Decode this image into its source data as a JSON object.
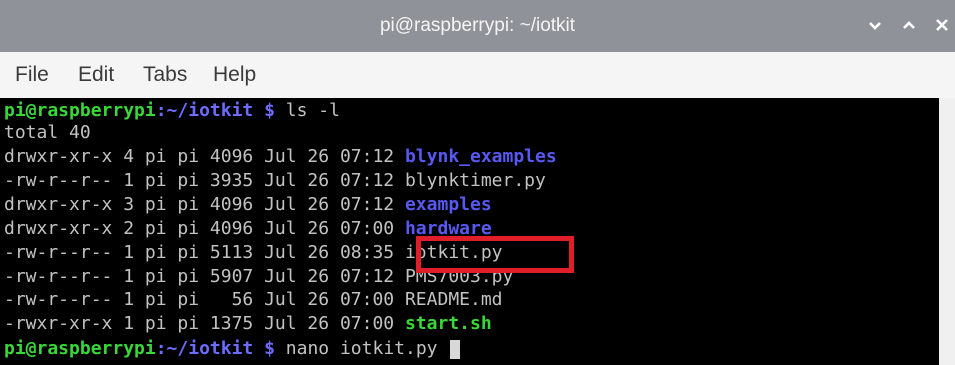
{
  "window": {
    "title": "pi@raspberrypi: ~/iotkit",
    "buttons": [
      "chevron-down-icon",
      "chevron-up-icon",
      "close-icon"
    ]
  },
  "menu": {
    "items": [
      "File",
      "Edit",
      "Tabs",
      "Help"
    ]
  },
  "terminal": {
    "prompt_user": "pi@raspberrypi",
    "prompt_path": ":~/iotkit",
    "prompt_symbol": " $",
    "command1": " ls -l",
    "total": "total 40",
    "entries": [
      {
        "meta": "drwxr-xr-x 4 pi pi 4096 Jul 26 07:12 ",
        "name": "blynk_examples",
        "kind": "dir"
      },
      {
        "meta": "-rw-r--r-- 1 pi pi 3935 Jul 26 07:12 ",
        "name": "blynktimer.py",
        "kind": "file"
      },
      {
        "meta": "drwxr-xr-x 3 pi pi 4096 Jul 26 07:12 ",
        "name": "examples",
        "kind": "dir"
      },
      {
        "meta": "drwxr-xr-x 2 pi pi 4096 Jul 26 07:00 ",
        "name": "hardware",
        "kind": "dir"
      },
      {
        "meta": "-rw-r--r-- 1 pi pi 5113 Jul 26 08:35 ",
        "name": "iotkit.py",
        "kind": "file"
      },
      {
        "meta": "-rw-r--r-- 1 pi pi 5907 Jul 26 07:12 ",
        "name": "PMS7003.py",
        "kind": "file"
      },
      {
        "meta": "-rw-r--r-- 1 pi pi   56 Jul 26 07:00 ",
        "name": "README.md",
        "kind": "file"
      },
      {
        "meta": "-rwxr-xr-x 1 pi pi 1375 Jul 26 07:00 ",
        "name": "start.sh",
        "kind": "exec"
      }
    ],
    "command2": " nano iotkit.py "
  },
  "colors": {
    "prompt_user": "#38d838",
    "prompt_path": "#6c6cff",
    "directory": "#5858f2",
    "executable": "#38d838",
    "highlight_box": "#e01e2a"
  }
}
